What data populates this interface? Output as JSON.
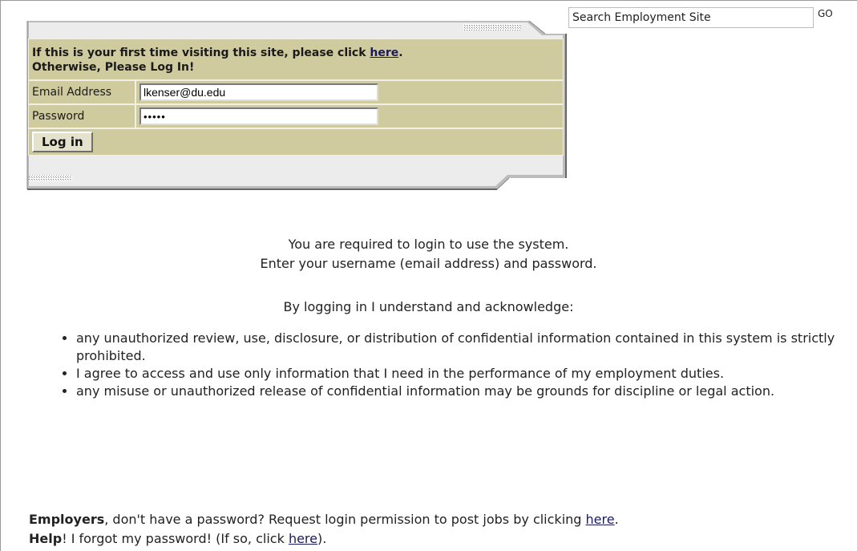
{
  "search": {
    "placeholder": "Search Employment Site",
    "value": "Search Employment Site",
    "go_label": "GO"
  },
  "login": {
    "prompt_part1": "If this is your first time visiting this site, please click ",
    "prompt_link": "here",
    "prompt_part2": ".",
    "prompt_line2": "Otherwise, Please Log In!",
    "email_label": "Email Address",
    "email_value": "lkenser@du.edu",
    "password_label": "Password",
    "password_value": "•••••",
    "login_button": "Log in"
  },
  "notice": {
    "line1": "You are required to login to use the system.",
    "line2": "Enter your username (email address) and password.",
    "line3": "By logging in I understand and acknowledge:",
    "rules": [
      "any unauthorized review, use, disclosure, or distribution of confidential information contained in this system is strictly prohibited.",
      "I agree to access and use only information that I need in the performance of my employment duties.",
      "any misuse or unauthorized release of confidential information may be grounds for discipline or legal action."
    ]
  },
  "employers": {
    "bold": "Employers",
    "text": ", don't have a password? Request login permission to post jobs by clicking ",
    "link": "here",
    "end": "."
  },
  "help": {
    "bold": "Help",
    "text": "! I forgot my password! (If so, click ",
    "link": "here",
    "end": ")."
  },
  "colors": {
    "panel": "#cfcb9e",
    "panel_border": "#f1f0e2",
    "link": "#1a1a5e"
  }
}
